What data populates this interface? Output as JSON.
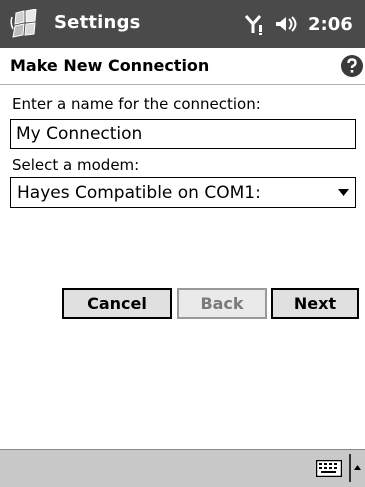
{
  "titlebar": {
    "app_title": "Settings",
    "time": "2:06"
  },
  "header": {
    "page_title": "Make New Connection"
  },
  "form": {
    "name_label": "Enter a name for the connection:",
    "name_value": "My Connection",
    "modem_label": "Select a modem:",
    "modem_value": "Hayes Compatible on COM1:"
  },
  "buttons": {
    "cancel": "Cancel",
    "back": "Back",
    "next": "Next"
  },
  "icons": {
    "start": "windows-start-flag-icon",
    "signal": "antenna-signal-icon",
    "volume": "speaker-volume-icon",
    "help": "help-question-icon",
    "dropdown": "dropdown-arrow-icon",
    "keyboard": "keyboard-icon",
    "sip": "input-panel-arrow-icon"
  },
  "colors": {
    "titlebar": "#4a4a4a",
    "bottombar": "#c8c8c8",
    "button": "#e0e0e0"
  }
}
